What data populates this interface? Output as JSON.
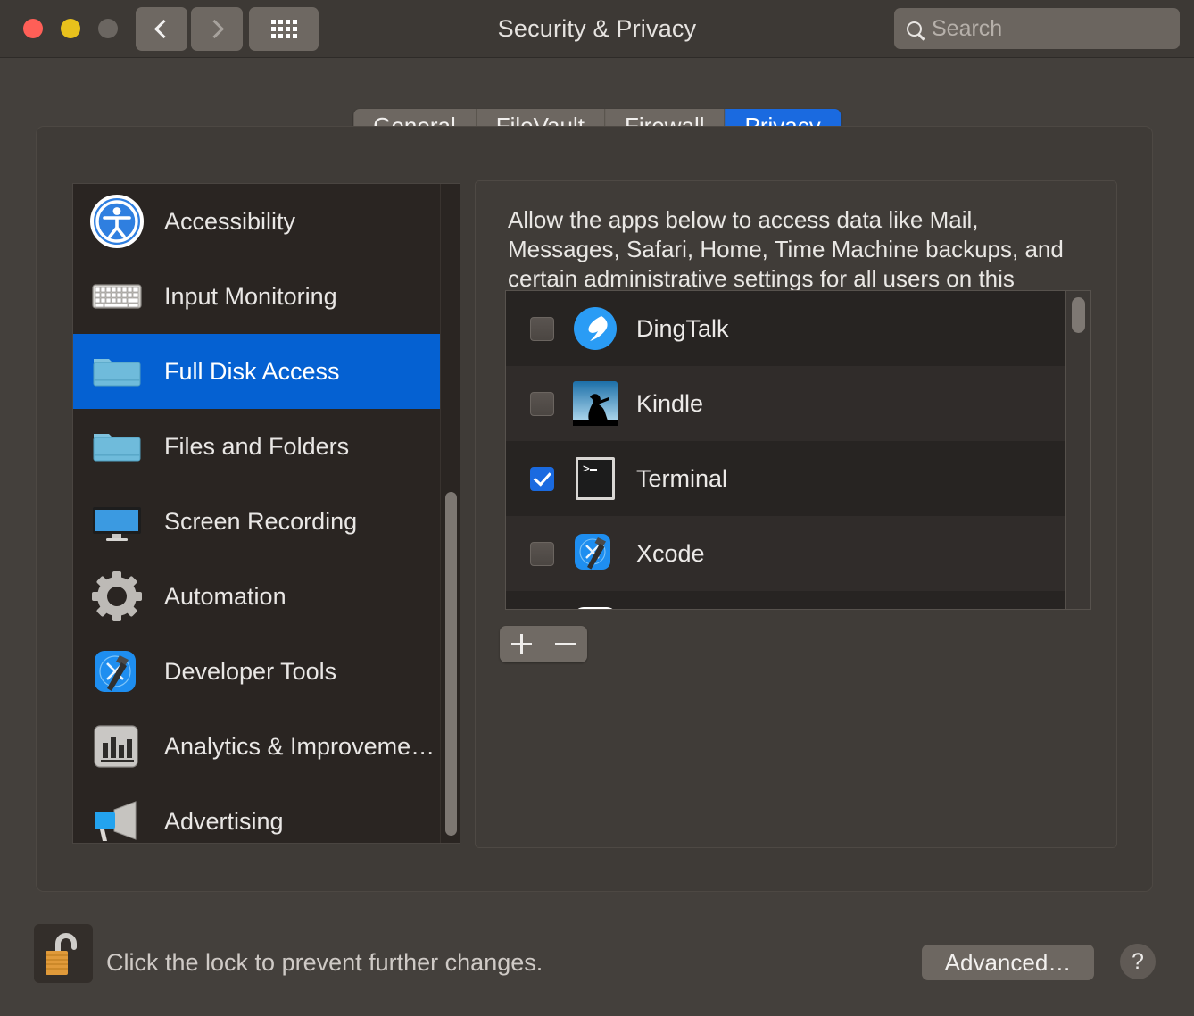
{
  "window": {
    "title": "Security & Privacy",
    "traffic_lights": [
      "close-red",
      "minimize-yellow",
      "zoom-gray"
    ],
    "nav_back": "back-chevron",
    "nav_forward": "forward-chevron",
    "grid_button": "show-all-preferences"
  },
  "search": {
    "placeholder": "Search",
    "value": ""
  },
  "tabs": [
    {
      "label": "General",
      "active": false
    },
    {
      "label": "FileVault",
      "active": false
    },
    {
      "label": "Firewall",
      "active": false
    },
    {
      "label": "Privacy",
      "active": true
    }
  ],
  "sidebar": {
    "items": [
      {
        "label": "Accessibility",
        "icon": "accessibility-icon",
        "selected": false
      },
      {
        "label": "Input Monitoring",
        "icon": "keyboard-icon",
        "selected": false
      },
      {
        "label": "Full Disk Access",
        "icon": "folder-icon",
        "selected": true
      },
      {
        "label": "Files and Folders",
        "icon": "folder-icon",
        "selected": false
      },
      {
        "label": "Screen Recording",
        "icon": "display-icon",
        "selected": false
      },
      {
        "label": "Automation",
        "icon": "gear-icon",
        "selected": false
      },
      {
        "label": "Developer Tools",
        "icon": "xcode-hammer-icon",
        "selected": false
      },
      {
        "label": "Analytics & Improveme…",
        "icon": "bar-chart-icon",
        "selected": false
      },
      {
        "label": "Advertising",
        "icon": "megaphone-icon",
        "selected": false
      }
    ]
  },
  "detail": {
    "description": "Allow the apps below to access data like Mail, Messages, Safari, Home, Time Machine backups, and certain administrative settings for all users on this",
    "apps": [
      {
        "name": "DingTalk",
        "icon": "dingtalk-icon",
        "checked": false
      },
      {
        "name": "Kindle",
        "icon": "kindle-icon",
        "checked": false
      },
      {
        "name": "Terminal",
        "icon": "terminal-icon",
        "checked": true
      },
      {
        "name": "Xcode",
        "icon": "xcode-icon",
        "checked": false
      }
    ],
    "add_label": "+",
    "remove_label": "−"
  },
  "footer": {
    "lock_icon": "unlocked-padlock-icon",
    "lock_message": "Click the lock to prevent further changes.",
    "advanced_label": "Advanced…",
    "help_label": "?"
  },
  "colors": {
    "window_bg": "#44403c",
    "titlebar_bg": "#3d3935",
    "sidebar_bg": "#2a2522",
    "selection_blue": "#0561d2",
    "tab_active_blue": "#1a6ae0",
    "row_bg": "#272422",
    "row_alt_bg": "#302c2a"
  }
}
